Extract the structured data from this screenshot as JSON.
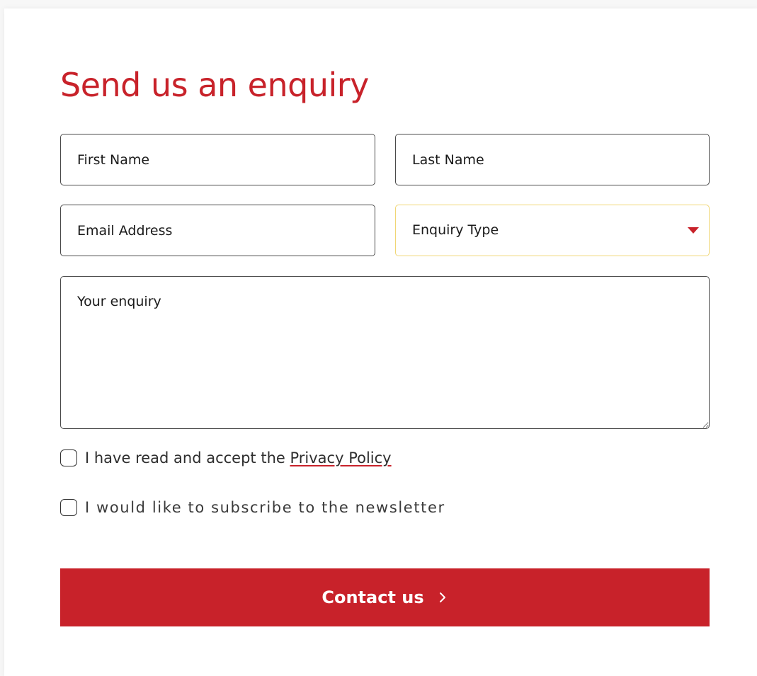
{
  "form": {
    "title": "Send us an enquiry",
    "first_name_placeholder": "First Name",
    "last_name_placeholder": "Last Name",
    "email_placeholder": "Email Address",
    "enquiry_type_label": "Enquiry Type",
    "enquiry_placeholder": "Your enquiry",
    "privacy_prefix": "I have read and accept the ",
    "privacy_link": "Privacy Policy",
    "newsletter_label": "I would like to subscribe to the newsletter",
    "submit_label": "Contact us",
    "submit_icon": "chevron-right-icon",
    "select_icon": "caret-down-icon"
  },
  "colors": {
    "accent": "#c8222a",
    "select_border": "#f0d675",
    "field_border": "#4a4a4a"
  }
}
